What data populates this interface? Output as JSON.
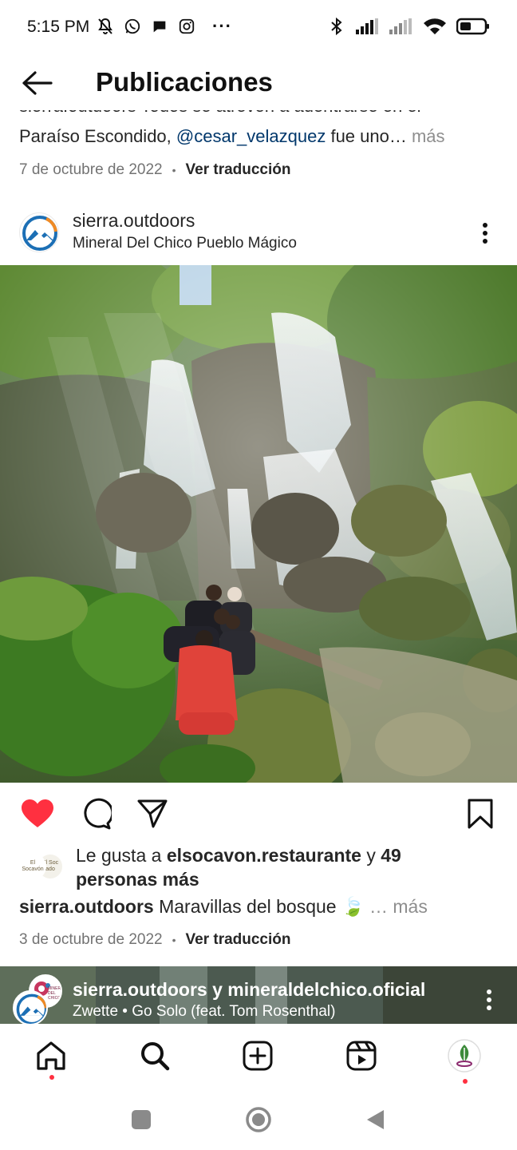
{
  "status_bar": {
    "time": "5:15 PM",
    "left_icons": [
      "bell-off-icon",
      "whatsapp-icon",
      "chat-bubble-icon",
      "instagram-icon"
    ],
    "more": "···",
    "right_icons": [
      "bluetooth-icon",
      "signal-icon",
      "signal-icon",
      "wifi-icon",
      "battery-icon"
    ]
  },
  "header": {
    "title": "Publicaciones"
  },
  "previous_post": {
    "caption_cut": "sierra.outdoors Todos se atreven a adentrarse en el",
    "caption_text": "Paraíso Escondido, ",
    "mention": "@cesar_velazquez",
    "caption_tail": " fue uno…",
    "more_label": " más",
    "date": "7 de octubre de 2022",
    "separator": "•",
    "translate_label": "Ver traducción"
  },
  "post": {
    "username": "sierra.outdoors",
    "location": "Mineral Del Chico Pueblo Mágico",
    "liked": true,
    "likes_prefix": "Le gusta a ",
    "likes_user": "elsocavon.restaurante",
    "likes_middle": " y ",
    "likes_count": "49",
    "likes_suffix": "personas más",
    "liker_avatar_1": "El Socavón",
    "liker_avatar_2": "El Soc ado",
    "caption_user": "sierra.outdoors",
    "caption_text": " Maravillas del bosque 🍃",
    "caption_more": "… más",
    "date": "3 de octubre de 2022",
    "separator": "•",
    "translate_label": "Ver traducción"
  },
  "next_post": {
    "users": "sierra.outdoors y mineraldelchico.oficial",
    "audio": "Zwette • Go Solo (feat. Tom Rosenthal)",
    "collab_avatar_text": "MINERAL DEL CHICO"
  },
  "bottom_nav": {
    "items": [
      "home-icon",
      "search-icon",
      "new-post-icon",
      "reels-icon",
      "profile-avatar"
    ]
  },
  "colors": {
    "like_red": "#ff3040",
    "mention_blue": "#00376b",
    "muted_gray": "#737373",
    "notification_dot": "#ff3040"
  }
}
